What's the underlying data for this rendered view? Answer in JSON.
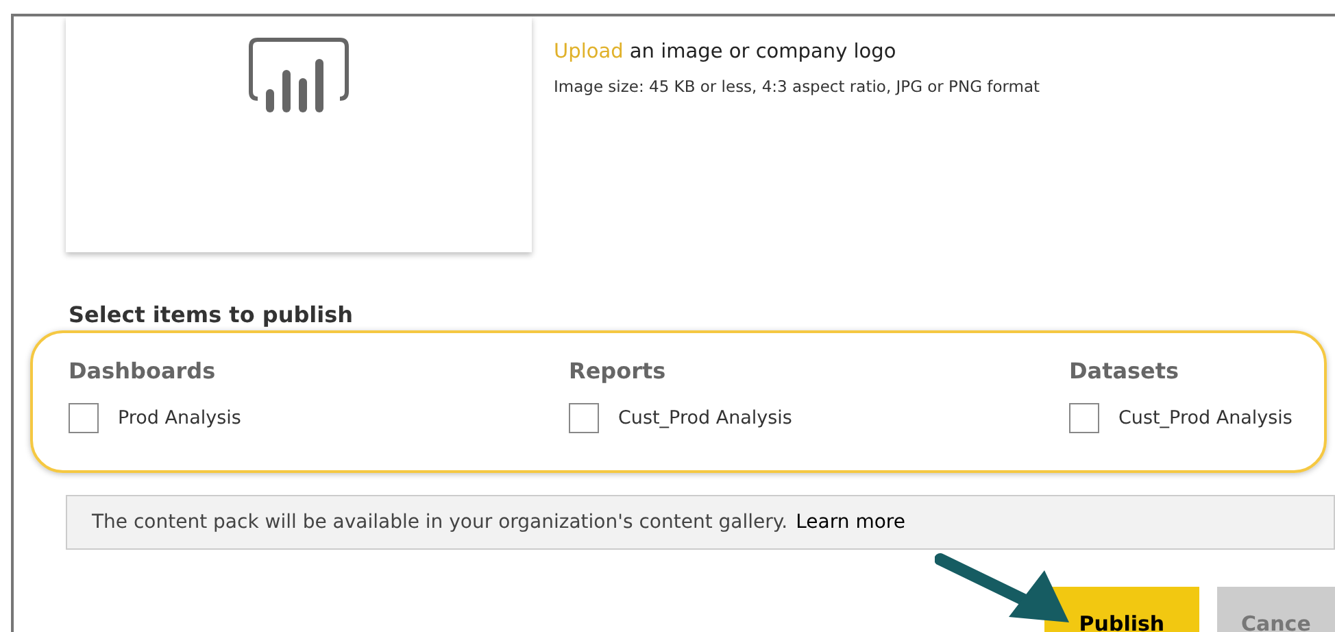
{
  "logo_upload": {
    "link": "Upload",
    "text": "an image or company logo",
    "hint": "Image size: 45 KB or less, 4:3 aspect ratio, JPG or PNG format"
  },
  "select_items": {
    "title": "Select items to publish",
    "groups": [
      {
        "heading": "Dashboards",
        "items": [
          {
            "label": "Prod Analysis",
            "checked": false
          }
        ]
      },
      {
        "heading": "Reports",
        "items": [
          {
            "label": "Cust_Prod Analysis",
            "checked": false
          }
        ]
      },
      {
        "heading": "Datasets",
        "items": [
          {
            "label": "Cust_Prod Analysis",
            "checked": false
          }
        ]
      }
    ]
  },
  "info_bar": {
    "text": "The content pack will be available in your organization's content gallery.",
    "link": "Learn more"
  },
  "buttons": [
    {
      "label": "Publish",
      "kind": "primary"
    },
    {
      "label": "Cance",
      "kind": "secondary"
    }
  ]
}
